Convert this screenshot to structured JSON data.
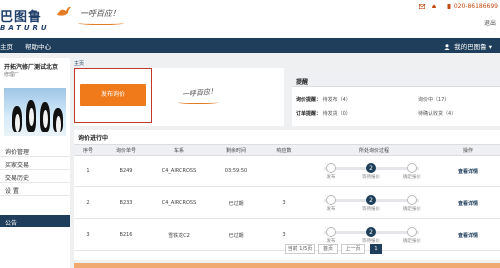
{
  "header": {
    "logo_cn": "巴图鲁",
    "logo_en": "BATURU",
    "slogan": "一呼百应！",
    "phone": "020-86186699",
    "link": "退出"
  },
  "nav": {
    "items": [
      "主页",
      "帮助中心"
    ],
    "my": "我的巴图鲁"
  },
  "sidebar": {
    "company": "开拓汽修厂测试北京",
    "role": "修理厂",
    "menu": [
      "询价管理",
      "买家交易",
      "交易历史",
      "设 置"
    ],
    "notice": "公告"
  },
  "breadcrumb": "主页",
  "publish": {
    "button": "发布询价",
    "slogan": "一呼百应！"
  },
  "reminders": {
    "title": "提醒",
    "inquiry_label": "询价提醒：",
    "inquiry_pending": "待发布（4）",
    "inquiry_progress": "询价中（17）",
    "order_label": "订单提醒：",
    "order_ship": "待发货（0）",
    "order_receive": "待确认收货（4）"
  },
  "table": {
    "title": "询价进行中",
    "columns": [
      "序号",
      "询价单号",
      "车系",
      "剩余时间",
      "响应数",
      "所处询价过程",
      "操作"
    ],
    "rows": [
      {
        "no": "1",
        "id": "B249",
        "car": "C4_AIRCROSS",
        "time": "03:59:50",
        "resp": "",
        "step": "2",
        "action": "查看详情"
      },
      {
        "no": "2",
        "id": "B233",
        "car": "C4_AIRCROSS",
        "time": "已过期",
        "resp": "3",
        "step": "2",
        "action": "查看详情"
      },
      {
        "no": "3",
        "id": "B216",
        "car": "雪铁龙C2",
        "time": "已过期",
        "resp": "3",
        "step": "2",
        "action": "查看详情"
      }
    ],
    "steps": [
      "发布",
      "等待报价",
      "确定报价"
    ]
  },
  "pagination": {
    "info": "当前 1/5页",
    "first": "首页",
    "prev": "上一页",
    "current": "1"
  },
  "colors": {
    "navy": "#1f3e5c",
    "orange": "#f07a1a",
    "highlight": "#c0392b"
  }
}
